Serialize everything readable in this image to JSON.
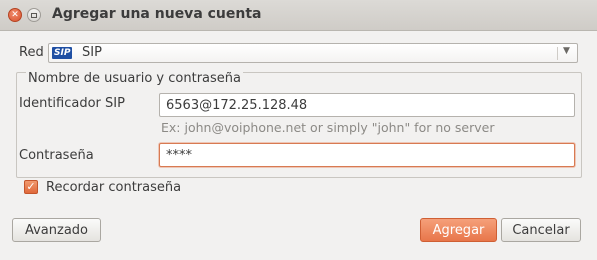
{
  "window": {
    "title": "Agregar una nueva cuenta"
  },
  "network": {
    "label": "Red",
    "icon_text": "SIP",
    "selected": "SIP"
  },
  "credentials": {
    "group_label": "Nombre de usuario y contraseña",
    "sip_id_label": "Identificador SIP",
    "sip_id_value": "6563@172.25.128.48",
    "sip_id_hint": "Ex: john@voiphone.net or simply \"john\" for no server",
    "password_label": "Contraseña",
    "password_value": "****"
  },
  "remember": {
    "label": "Recordar contraseña",
    "checked": true
  },
  "buttons": {
    "advanced": "Avanzado",
    "add": "Agregar",
    "cancel": "Cancelar"
  },
  "colors": {
    "accent": "#e8764a",
    "window_bg": "#f2f1f0"
  }
}
